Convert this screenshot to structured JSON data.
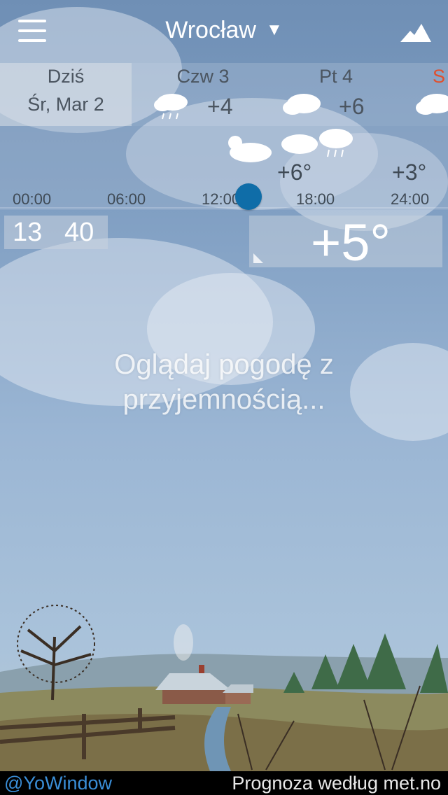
{
  "header": {
    "city": "Wrocław"
  },
  "days": [
    {
      "name": "Dziś",
      "date": "Śr, Mar 2"
    },
    {
      "name": "Czw 3",
      "temp": "+4"
    },
    {
      "name": "Pt 4",
      "temp": "+6"
    },
    {
      "name": "S"
    }
  ],
  "hourly": {
    "times": [
      "00:00",
      "06:00",
      "12:00",
      "18:00",
      "24:00"
    ],
    "temps": [
      "+6°",
      "+3°"
    ]
  },
  "time": {
    "hour": "13",
    "minute": "40"
  },
  "current_temp": "+5°",
  "tagline": {
    "line1": "Oglądaj pogodę z",
    "line2": "przyjemnością..."
  },
  "footer": {
    "left": "@YoWindow",
    "right": "Prognoza według met.no"
  },
  "colors": {
    "accent": "#0f6da8",
    "link": "#3a8ed8",
    "weekend": "#e0502e"
  },
  "icons": [
    "menu-icon",
    "landscape-icon",
    "rain-cloud-icon",
    "cloud-icon",
    "partly-cloudy-icon"
  ]
}
